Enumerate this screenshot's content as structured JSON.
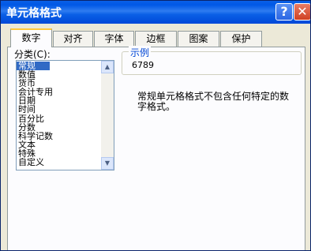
{
  "dialog": {
    "title": "单元格格式",
    "help_glyph": "?",
    "close_glyph": "✕",
    "help_icon": "question-mark-icon",
    "close_icon": "close-x-icon"
  },
  "tabs": [
    {
      "label": "数字",
      "active": true
    },
    {
      "label": "对齐",
      "active": false
    },
    {
      "label": "字体",
      "active": false
    },
    {
      "label": "边框",
      "active": false
    },
    {
      "label": "图案",
      "active": false
    },
    {
      "label": "保护",
      "active": false
    }
  ],
  "number_tab": {
    "category_label": "分类(C):",
    "categories": [
      "常规",
      "数值",
      "货币",
      "会计专用",
      "日期",
      "时间",
      "百分比",
      "分数",
      "科学记数",
      "文本",
      "特殊",
      "自定义"
    ],
    "selected_category": "常规",
    "sample_label": "示例",
    "sample_value": "6789",
    "description": "常规单元格格式不包含任何特定的数字格式。"
  },
  "colors": {
    "titlebar": "#0058e6",
    "selection": "#316ac5",
    "active_tab_highlight": "#ffc83c",
    "group_label": "#0046d5"
  }
}
